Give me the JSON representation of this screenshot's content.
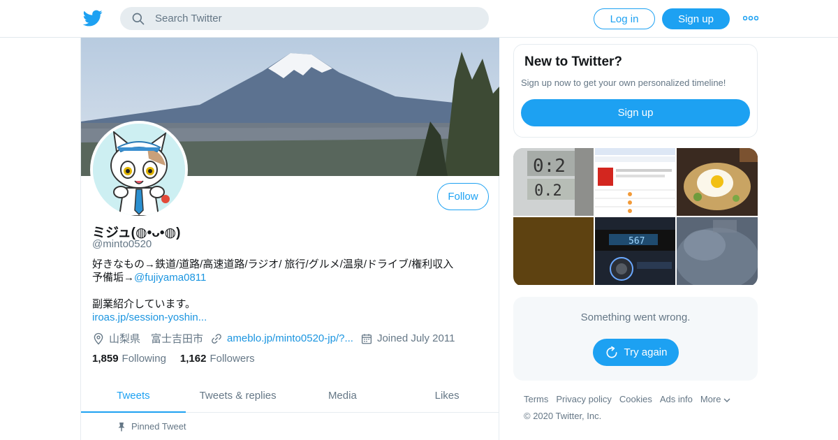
{
  "header": {
    "search_placeholder": "Search Twitter",
    "login_label": "Log in",
    "signup_label": "Sign up",
    "brand_color": "#1da1f2"
  },
  "profile": {
    "name": "ミジュ(◍•ᴗ•◍)",
    "handle": "@minto0520",
    "follow_label": "Follow",
    "bio_line1": "好きなもの→鉄道/道路/高速道路/ラジオ/ 旅行/グルメ/温泉/ドライブ/権利収入",
    "bio_line2_prefix": "予備垢→",
    "bio_mention": "@fujiyama0811",
    "bio_line3": "副業紹介しています。",
    "bio_link": "iroas.jp/session-yoshin...",
    "location": "山梨県　富士吉田市",
    "website": "ameblo.jp/minto0520-jp/?...",
    "joined": "Joined July 2011",
    "following_count": "1,859",
    "following_label": "Following",
    "followers_count": "1,162",
    "followers_label": "Followers"
  },
  "tabs": [
    {
      "label": "Tweets",
      "active": true
    },
    {
      "label": "Tweets & replies",
      "active": false
    },
    {
      "label": "Media",
      "active": false
    },
    {
      "label": "Likes",
      "active": false
    }
  ],
  "pinned_label": "Pinned Tweet",
  "sidebar": {
    "new_title": "New to Twitter?",
    "new_text": "Sign up now to get your own personalized timeline!",
    "new_signup_label": "Sign up",
    "error_text": "Something went wrong.",
    "retry_label": "Try again"
  },
  "footer": {
    "links": [
      "Terms",
      "Privacy policy",
      "Cookies",
      "Ads info",
      "More"
    ],
    "copyright": "© 2020 Twitter, Inc."
  }
}
